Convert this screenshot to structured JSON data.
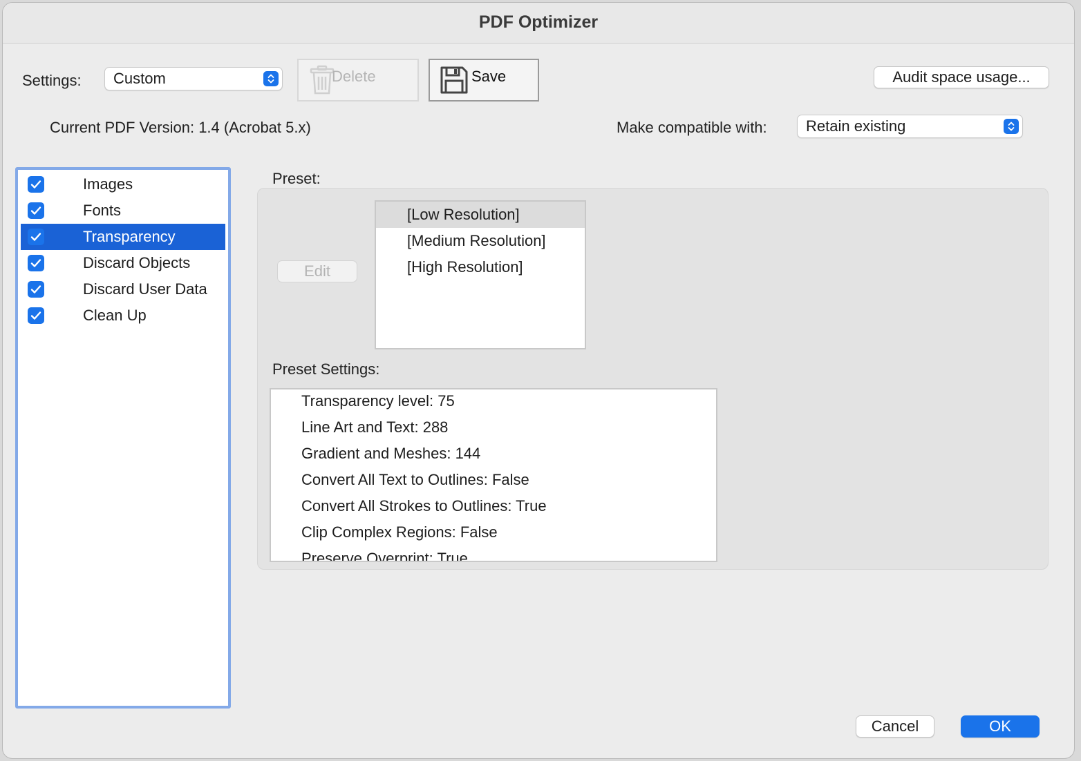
{
  "window": {
    "title": "PDF Optimizer"
  },
  "toolbar": {
    "settings_label": "Settings:",
    "settings_value": "Custom",
    "delete_label": "Delete",
    "save_label": "Save",
    "audit_label": "Audit space usage..."
  },
  "version": {
    "current_label": "Current PDF Version: 1.4 (Acrobat 5.x)",
    "compatible_label": "Make compatible with:",
    "compatible_value": "Retain existing"
  },
  "sidebar": {
    "items": [
      {
        "label": "Images",
        "checked": true,
        "selected": false
      },
      {
        "label": "Fonts",
        "checked": true,
        "selected": false
      },
      {
        "label": "Transparency",
        "checked": true,
        "selected": true
      },
      {
        "label": "Discard Objects",
        "checked": true,
        "selected": false
      },
      {
        "label": "Discard User Data",
        "checked": true,
        "selected": false
      },
      {
        "label": "Clean Up",
        "checked": true,
        "selected": false
      }
    ]
  },
  "preset": {
    "label": "Preset:",
    "edit_label": "Edit",
    "items": [
      {
        "label": "[Low Resolution]",
        "selected": true
      },
      {
        "label": "[Medium Resolution]",
        "selected": false
      },
      {
        "label": "[High Resolution]",
        "selected": false
      }
    ]
  },
  "preset_settings": {
    "label": "Preset Settings:",
    "items": [
      "Transparency level: 75",
      "Line Art and Text: 288",
      "Gradient and Meshes: 144",
      "Convert All Text to Outlines: False",
      "Convert All Strokes to Outlines: True",
      "Clip Complex Regions: False",
      "Preserve Overprint: True"
    ]
  },
  "footer": {
    "cancel_label": "Cancel",
    "ok_label": "OK"
  },
  "colors": {
    "accent": "#1a73ea",
    "selection": "#1a62d6",
    "focus_ring": "#83a9e8"
  }
}
